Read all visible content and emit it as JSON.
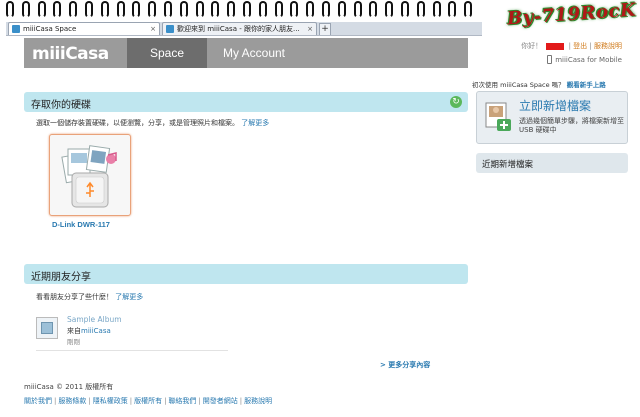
{
  "watermark": "By-719RocK",
  "browser": {
    "tabs": [
      {
        "label": "miiiCasa Space",
        "active": true
      },
      {
        "label": "歡迎來到 miiiCasa - 跟你的家人朋友...",
        "active": false
      }
    ],
    "new_tab": "+",
    "close": "×"
  },
  "header": {
    "logo": "miiiCasa",
    "nav": {
      "space": "Space",
      "account": "My Account"
    },
    "user": {
      "hello": "你好！",
      "logout": "登出",
      "help": "服務說明"
    },
    "mobile": "miiiCasa for Mobile"
  },
  "storage": {
    "title": "存取你的硬碟",
    "desc": "選取一個儲存裝置硬碟，以便瀏覽，分享，或是管理照片和檔案。",
    "learn_more": "了解更多",
    "device_label": "D-Link DWR-117"
  },
  "friends": {
    "title": "近期朋友分享",
    "desc": "看看朋友分享了些什麼！",
    "learn_more": "了解更多",
    "album": {
      "name": "Sample Album",
      "from_prefix": "來自",
      "from": "miiiCasa",
      "time": "剛剛"
    },
    "more": "> 更多分享內容"
  },
  "right_panel": {
    "intro": "初次使用 miiiCasa Space 嗎？",
    "guide": "觀看新手上路",
    "add_title": "立即新增檔案",
    "add_desc": "透過幾個簡單步驟，將檔案新增至 USB 硬碟中",
    "recent_files": "近期新增檔案"
  },
  "footer": {
    "copyright": "miiiCasa © 2011   版權所有",
    "links": [
      "關於我們",
      "服務條款",
      "隱私權政策",
      "版權所有",
      "聯絡我們",
      "開發者網站",
      "服務說明"
    ]
  }
}
